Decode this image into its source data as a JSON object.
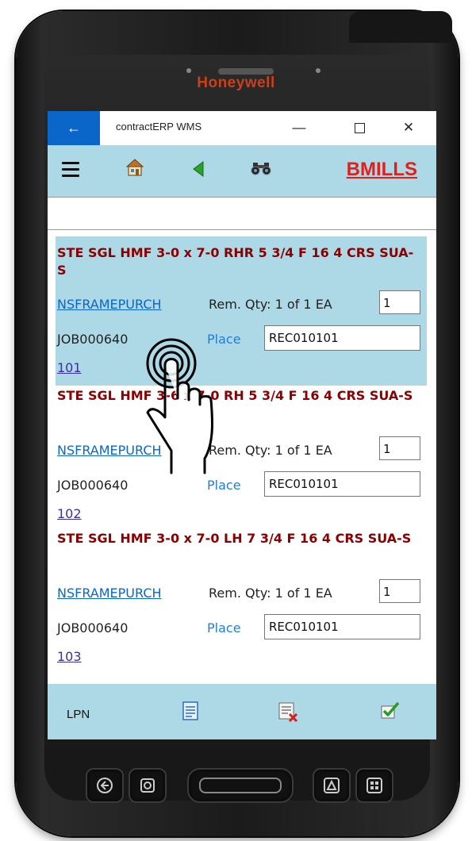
{
  "device": {
    "brand": "Honeywell"
  },
  "window": {
    "back_glyph": "←",
    "title": "contractERP WMS",
    "minimize_glyph": "—",
    "close_glyph": "✕"
  },
  "toolbar": {
    "user": "BMILLS"
  },
  "items": [
    {
      "desc": "STE SGL HMF 3-0 x 7-0 RHR 5 3/4 F 16 4 CRS SUA-S",
      "link": "NSFRAMEPURCH",
      "rem_qty": "Rem. Qty: 1 of 1 EA",
      "qty": "1",
      "job": "JOB000640",
      "place": "Place",
      "location": "REC010101",
      "number": "101",
      "selected": true
    },
    {
      "desc": "STE SGL HMF 3-6 x 7-0 RH 5 3/4 F 16 4 CRS SUA-S",
      "link": "NSFRAMEPURCH",
      "rem_qty": "Rem. Qty: 1 of 1 EA",
      "qty": "1",
      "job": "JOB000640",
      "place": "Place",
      "location": "REC010101",
      "number": "102",
      "selected": false
    },
    {
      "desc": "STE SGL HMF 3-0 x 7-0 LH 7 3/4 F 16 4 CRS SUA-S",
      "link": "NSFRAMEPURCH",
      "rem_qty": "Rem. Qty: 1 of 1 EA",
      "qty": "1",
      "job": "JOB000640",
      "place": "Place",
      "location": "REC010101",
      "number": "103",
      "selected": false
    }
  ],
  "bottom_bar": {
    "lpn": "LPN"
  },
  "colors": {
    "toolbar_bg": "#add8e6",
    "titlebar_accent": "#0a66c9",
    "user_red": "#e0201c",
    "desc_darkred": "#8b0000",
    "link_blue": "#0a66c9",
    "brand_orange": "#c8401c"
  },
  "icons": {
    "menu": "hamburger-icon",
    "home": "home-icon",
    "back": "green-back-arrow-icon",
    "search": "binoculars-icon",
    "notes": "notes-icon",
    "delete": "delete-list-icon",
    "confirm": "checkmark-icon"
  }
}
